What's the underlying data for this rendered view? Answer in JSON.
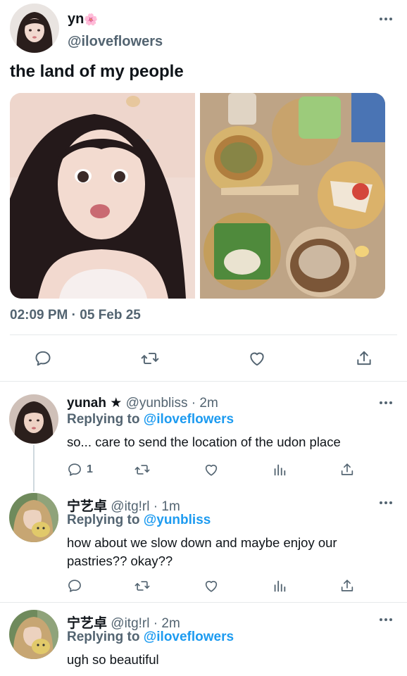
{
  "main_tweet": {
    "author_name": "yn",
    "author_emoji": "🌸",
    "author_handle": "@iloveflowers",
    "text": "the land of my people",
    "timestamp": "02:09 PM · 05 Feb 25",
    "actions": [
      "reply-icon",
      "retweet-icon",
      "like-icon",
      "share-icon"
    ]
  },
  "replies": [
    {
      "name": "yunah",
      "star": "★",
      "handle": "@yunbliss",
      "time": "· 2m",
      "replying_prefix": "Replying to",
      "replying_to": "@iloveflowers",
      "text": "so... care to send the location of the udon place",
      "reply_count": "1"
    },
    {
      "name": "宁艺卓",
      "handle": "@itg!rl",
      "time": "· 1m",
      "replying_prefix": "Replying to",
      "replying_to": "@yunbliss",
      "text": "how about we slow down and maybe enjoy our pastries?? okay??",
      "reply_count": ""
    },
    {
      "name": "宁艺卓",
      "handle": "@itg!rl",
      "time": "· 2m",
      "replying_prefix": "Replying to",
      "replying_to": "@iloveflowers",
      "text": "ugh so beautiful",
      "reply_count": ""
    }
  ],
  "colors": {
    "text": "#0f1419",
    "secondary": "#536471",
    "accent": "#1d9bf0",
    "divider": "#e6e9eb"
  }
}
